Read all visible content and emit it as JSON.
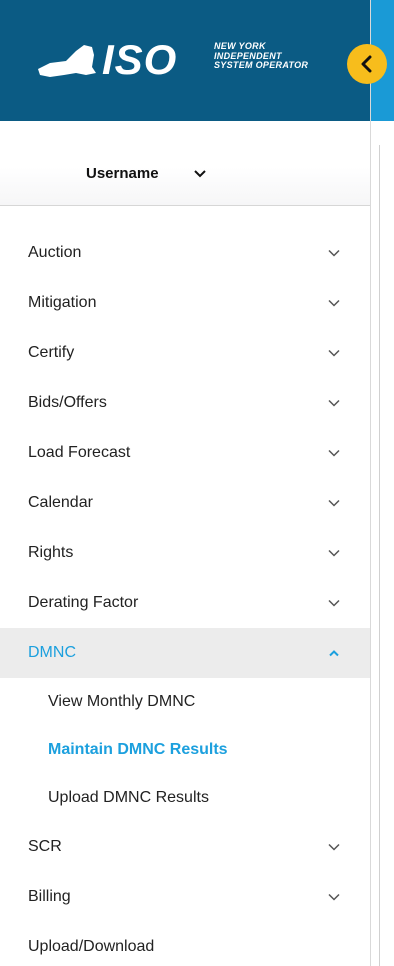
{
  "brand": {
    "logo_mark": "ISO",
    "logo_lines": [
      "NEW YORK",
      "INDEPENDENT",
      "SYSTEM OPERATOR"
    ],
    "header_color": "#0b5b84",
    "accent_color": "#1ca0de",
    "collapse_button_color": "#f7bd1c"
  },
  "collapse_button": {
    "icon": "chevron-left-icon"
  },
  "user": {
    "name": "Username",
    "icon": "chevron-down-icon"
  },
  "menu": [
    {
      "label": "Auction",
      "icon": "chevron-down-icon"
    },
    {
      "label": "Mitigation",
      "icon": "chevron-down-icon"
    },
    {
      "label": "Certify",
      "icon": "chevron-down-icon"
    },
    {
      "label": "Bids/Offers",
      "icon": "chevron-down-icon"
    },
    {
      "label": "Load Forecast",
      "icon": "chevron-down-icon"
    },
    {
      "label": "Calendar",
      "icon": "chevron-down-icon"
    },
    {
      "label": "Rights",
      "icon": "chevron-down-icon"
    },
    {
      "label": "Derating Factor",
      "icon": "chevron-down-icon"
    },
    {
      "label": "DMNC",
      "icon": "chevron-up-icon",
      "expanded": true,
      "subitems": [
        {
          "label": "View Monthly DMNC"
        },
        {
          "label": "Maintain DMNC Results",
          "selected": true
        },
        {
          "label": "Upload DMNC Results"
        }
      ]
    },
    {
      "label": "SCR",
      "icon": "chevron-down-icon"
    },
    {
      "label": "Billing",
      "icon": "chevron-down-icon"
    },
    {
      "label": "Upload/Download"
    }
  ]
}
